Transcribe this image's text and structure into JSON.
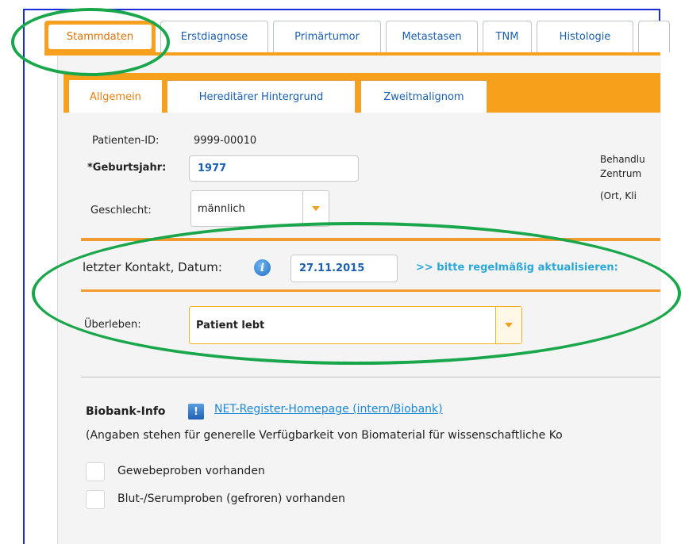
{
  "tabs": [
    "Stammdaten",
    "Erstdiagnose",
    "Primärtumor",
    "Metastasen",
    "TNM",
    "Histologie"
  ],
  "subtabs": [
    "Allgemein",
    "Hereditärer Hintergrund",
    "Zweitmalignom"
  ],
  "patient": {
    "id_label": "Patienten-ID:",
    "id_value": "9999-00010",
    "birth_label": "*Geburtsjahr:",
    "birth_value": "1977",
    "sex_label": "Geschlecht:",
    "sex_value": "männlich"
  },
  "side_text": {
    "line1": "Behandlu",
    "line2": "Zentrum",
    "line3": "(Ort, Kli"
  },
  "contact": {
    "label": "letzter Kontakt, Datum:",
    "date": "27.11.2015",
    "hint": ">> bitte regelmäßig aktualisieren:"
  },
  "survival": {
    "label": "Überleben:",
    "value": "Patient lebt"
  },
  "biobank": {
    "label": "Biobank-Info",
    "icon_glyph": "!",
    "link": "NET-Register-Homepage (intern/Biobank)",
    "note": "(Angaben stehen für generelle Verfügbarkeit von Biomaterial für wissenschaftliche Ko",
    "checkbox1": "Gewebeproben vorhanden",
    "checkbox2": "Blut-/Serumproben (gefroren) vorhanden"
  },
  "colors": {
    "accent": "#f7a01c",
    "link": "#1e88d6",
    "annotation": "#1aa64a",
    "frame": "#1c2bd8"
  }
}
